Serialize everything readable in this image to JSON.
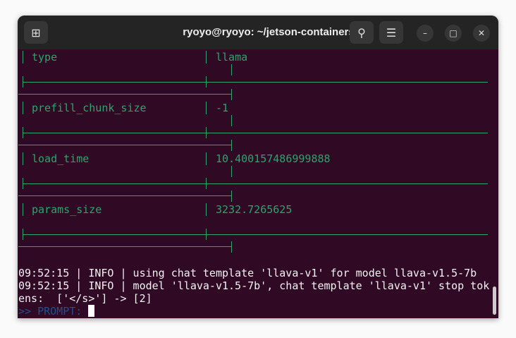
{
  "window": {
    "title": "ryoyo@ryoyo: ~/jetson-containers"
  },
  "buttons": {
    "new_tab": "new-tab",
    "search": "search",
    "menu": "menu",
    "minimize": "minimize",
    "maximize": "maximize",
    "close": "close"
  },
  "table": {
    "rows": [
      {
        "key": "type",
        "value": "llama"
      },
      {
        "key": "prefill_chunk_size",
        "value": "-1"
      },
      {
        "key": "load_time",
        "value": "10.400157486999888"
      },
      {
        "key": "params_size",
        "value": "3232.7265625"
      }
    ]
  },
  "log": {
    "lines": [
      "09:52:15 | INFO | using chat template 'llava-v1' for model llava-v1.5-7b",
      "09:52:15 | INFO | model 'llava-v1.5-7b', chat template 'llava-v1' stop tok",
      "ens:  ['</s>'] -> [2]"
    ],
    "prompt": ">> PROMPT: "
  },
  "colors": {
    "background": "#300a24",
    "table_text": "#2ea36b",
    "prompt": "#1f4f8f"
  }
}
